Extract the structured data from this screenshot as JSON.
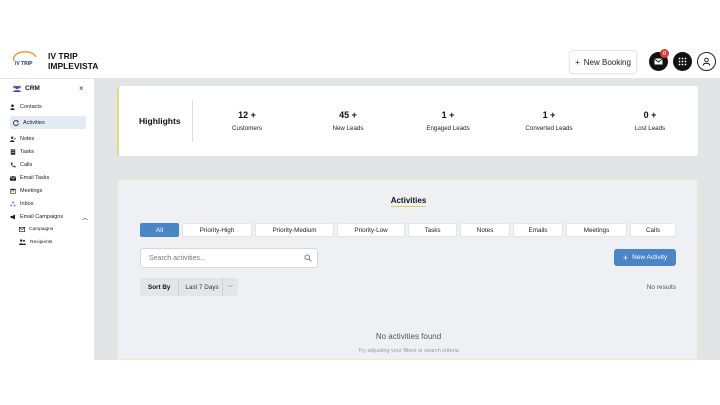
{
  "header": {
    "brand_line1": "IV TRIP",
    "brand_line2": "IMPLEVISTA",
    "logo_text": "IV TRIP",
    "new_booking": "New Booking",
    "notification_count": "0",
    "icons": [
      "mail-icon",
      "grid-icon",
      "user-icon"
    ]
  },
  "sidebar": {
    "title": "CRM",
    "close": "×",
    "items": [
      {
        "label": "Contacts",
        "icon": "contacts-icon"
      },
      {
        "label": "Activities",
        "icon": "activities-icon",
        "active": true
      },
      {
        "label": "Notes",
        "icon": "notes-icon"
      },
      {
        "label": "Tasks",
        "icon": "tasks-icon"
      },
      {
        "label": "Calls",
        "icon": "phone-icon"
      },
      {
        "label": "Email Tasks",
        "icon": "email-icon"
      },
      {
        "label": "Meetings",
        "icon": "calendar-icon"
      },
      {
        "label": "Inbox",
        "icon": "inbox-icon"
      },
      {
        "label": "Email Campaigns",
        "icon": "megaphone-icon"
      },
      {
        "label": "Campaigns",
        "icon": "campaign-icon"
      },
      {
        "label": "Recipients",
        "icon": "recipients-icon"
      }
    ]
  },
  "highlights": {
    "title": "Highlights",
    "stats": [
      {
        "value": "12 +",
        "label": "Customers"
      },
      {
        "value": "45 +",
        "label": "New Leads"
      },
      {
        "value": "1 +",
        "label": "Engaged Leads"
      },
      {
        "value": "1 +",
        "label": "Converted Leads"
      },
      {
        "value": "0 +",
        "label": "Lost Leads"
      }
    ]
  },
  "activities": {
    "title": "Activities",
    "tabs": [
      "All",
      "Priority-High",
      "Priority-Medium",
      "Priority-Low",
      "Tasks",
      "Notes",
      "Emails",
      "Meetings",
      "Calls"
    ],
    "search_placeholder": "Search activities...",
    "new_activity": "New Activity",
    "sort_label": "Sort By",
    "sort_value": "Last 7 Days",
    "no_results": "No results",
    "empty_title": "No activities found",
    "empty_subtitle": "Try adjusting your filters or search criteria"
  },
  "colors": {
    "accent": "#4a86c5",
    "highlight_border": "#e8d879",
    "badge": "#e53935"
  }
}
